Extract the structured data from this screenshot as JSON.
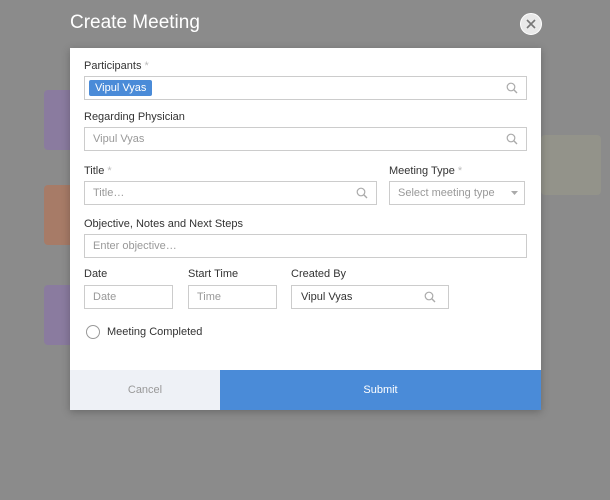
{
  "dialog": {
    "title": "Create Meeting",
    "close_icon": "close-icon"
  },
  "form": {
    "participants": {
      "label": "Participants",
      "required_mark": "*",
      "chip": "Vipul Vyas"
    },
    "regarding": {
      "label": "Regarding Physician",
      "placeholder": "Vipul Vyas"
    },
    "title": {
      "label": "Title",
      "required_mark": "*",
      "placeholder": "Title…"
    },
    "meeting_type": {
      "label": "Meeting Type",
      "required_mark": "*",
      "placeholder": "Select meeting type"
    },
    "objective": {
      "label": "Objective, Notes and Next Steps",
      "placeholder": "Enter objective…"
    },
    "date": {
      "label": "Date",
      "placeholder": "Date"
    },
    "start_time": {
      "label": "Start Time",
      "placeholder": "Time"
    },
    "created_by": {
      "label": "Created By",
      "value": "Vipul Vyas"
    },
    "meeting_completed": {
      "label": "Meeting Completed",
      "checked": false
    }
  },
  "footer": {
    "cancel_label": "Cancel",
    "submit_label": "Submit"
  },
  "colors": {
    "accent": "#4a8bd8",
    "overlay": "#8a8a8a",
    "cancel_bg": "#eef1f6"
  }
}
